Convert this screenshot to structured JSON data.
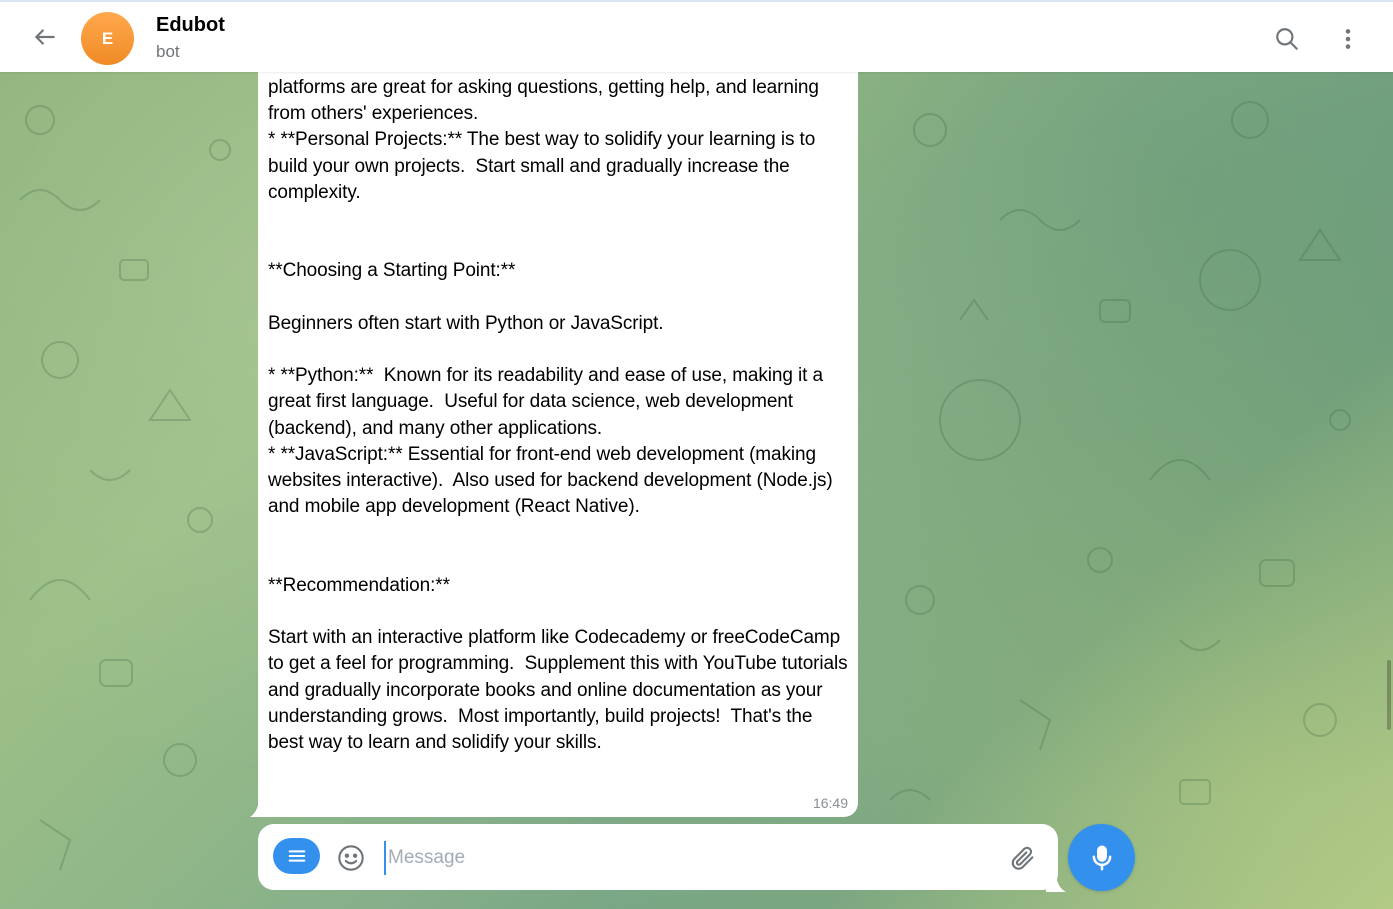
{
  "header": {
    "back_icon": "arrow-left-icon",
    "avatar_letter": "E",
    "avatar_color": "#f28c28",
    "title": "Edubot",
    "subtitle": "bot",
    "search_icon": "search-icon",
    "menu_icon": "more-vertical-icon"
  },
  "message": {
    "text": "platforms are great for asking questions, getting help, and learning from others' experiences.\n* **Personal Projects:** The best way to solidify your learning is to build your own projects.  Start small and gradually increase the complexity.\n\n\n**Choosing a Starting Point:**\n\nBeginners often start with Python or JavaScript.\n\n* **Python:**  Known for its readability and ease of use, making it a great first language.  Useful for data science, web development (backend), and many other applications.\n* **JavaScript:** Essential for front-end web development (making websites interactive).  Also used for backend development (Node.js) and mobile app development (React Native).\n\n\n**Recommendation:**\n\nStart with an interactive platform like Codecademy or freeCodeCamp to get a feel for programming.  Supplement this with YouTube tutorials and gradually incorporate books and online documentation as your understanding grows.  Most importantly, build projects!  That's the best way to learn and solidify your skills.",
    "time": "16:49"
  },
  "composer": {
    "placeholder": "Message",
    "value": "",
    "bot_menu_icon": "menu-lines-icon",
    "emoji_icon": "smile-icon",
    "attach_icon": "paperclip-icon",
    "mic_icon": "microphone-icon"
  },
  "colors": {
    "accent": "#3390ec",
    "bubble": "#ffffff",
    "secondary_text": "#707579"
  }
}
